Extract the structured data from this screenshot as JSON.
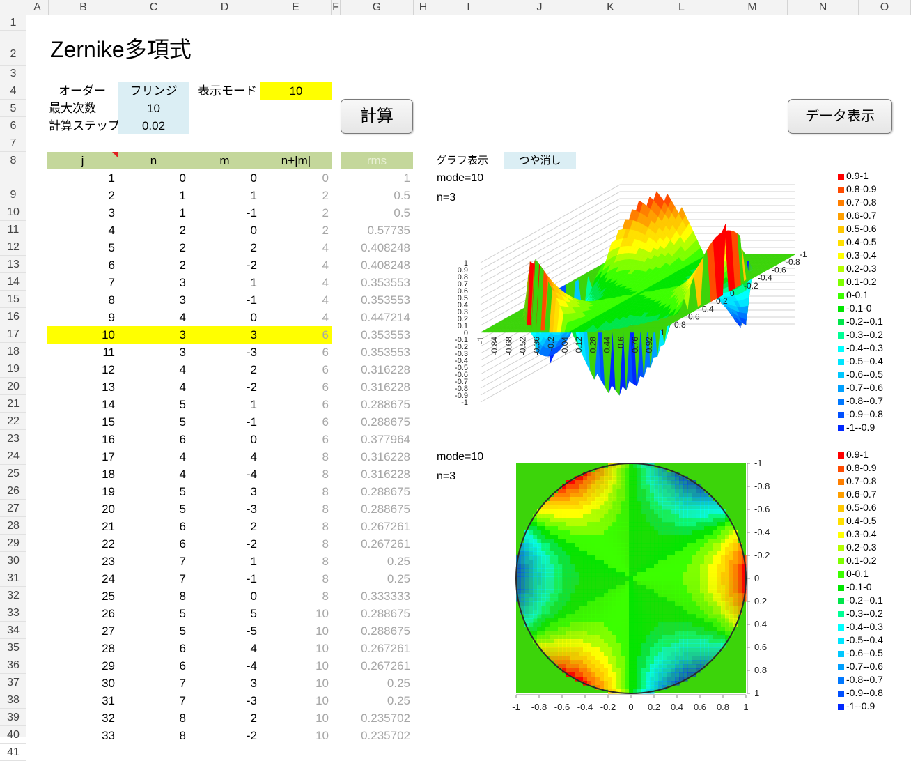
{
  "columns": [
    "A",
    "B",
    "C",
    "D",
    "E",
    "F",
    "G",
    "H",
    "I",
    "J",
    "K",
    "L",
    "M",
    "N",
    "O"
  ],
  "title": "Zernike多項式",
  "settings": {
    "order_label": "オーダー",
    "order_value": "フリンジ",
    "max_degree_label": "最大次数",
    "max_degree_value": "10",
    "step_label": "計算ステップ",
    "step_value": "0.02",
    "mode_label": "表示モード",
    "mode_value": "10"
  },
  "buttons": {
    "calc": "計算",
    "data": "データ表示"
  },
  "table_headers": {
    "j": "j",
    "n": "n",
    "m": "m",
    "nm": "n+|m|",
    "rms": "rms"
  },
  "graph_display": {
    "label": "グラフ表示",
    "value": "つや消し"
  },
  "rows": [
    {
      "j": "1",
      "n": "0",
      "m": "0",
      "nm": "0",
      "rms": "1"
    },
    {
      "j": "2",
      "n": "1",
      "m": "1",
      "nm": "2",
      "rms": "0.5"
    },
    {
      "j": "3",
      "n": "1",
      "m": "-1",
      "nm": "2",
      "rms": "0.5"
    },
    {
      "j": "4",
      "n": "2",
      "m": "0",
      "nm": "2",
      "rms": "0.57735"
    },
    {
      "j": "5",
      "n": "2",
      "m": "2",
      "nm": "4",
      "rms": "0.408248"
    },
    {
      "j": "6",
      "n": "2",
      "m": "-2",
      "nm": "4",
      "rms": "0.408248"
    },
    {
      "j": "7",
      "n": "3",
      "m": "1",
      "nm": "4",
      "rms": "0.353553"
    },
    {
      "j": "8",
      "n": "3",
      "m": "-1",
      "nm": "4",
      "rms": "0.353553"
    },
    {
      "j": "9",
      "n": "4",
      "m": "0",
      "nm": "4",
      "rms": "0.447214"
    },
    {
      "j": "10",
      "n": "3",
      "m": "3",
      "nm": "6",
      "rms": "0.353553",
      "highlight": true
    },
    {
      "j": "11",
      "n": "3",
      "m": "-3",
      "nm": "6",
      "rms": "0.353553"
    },
    {
      "j": "12",
      "n": "4",
      "m": "2",
      "nm": "6",
      "rms": "0.316228"
    },
    {
      "j": "13",
      "n": "4",
      "m": "-2",
      "nm": "6",
      "rms": "0.316228"
    },
    {
      "j": "14",
      "n": "5",
      "m": "1",
      "nm": "6",
      "rms": "0.288675"
    },
    {
      "j": "15",
      "n": "5",
      "m": "-1",
      "nm": "6",
      "rms": "0.288675"
    },
    {
      "j": "16",
      "n": "6",
      "m": "0",
      "nm": "6",
      "rms": "0.377964"
    },
    {
      "j": "17",
      "n": "4",
      "m": "4",
      "nm": "8",
      "rms": "0.316228"
    },
    {
      "j": "18",
      "n": "4",
      "m": "-4",
      "nm": "8",
      "rms": "0.316228"
    },
    {
      "j": "19",
      "n": "5",
      "m": "3",
      "nm": "8",
      "rms": "0.288675"
    },
    {
      "j": "20",
      "n": "5",
      "m": "-3",
      "nm": "8",
      "rms": "0.288675"
    },
    {
      "j": "21",
      "n": "6",
      "m": "2",
      "nm": "8",
      "rms": "0.267261"
    },
    {
      "j": "22",
      "n": "6",
      "m": "-2",
      "nm": "8",
      "rms": "0.267261"
    },
    {
      "j": "23",
      "n": "7",
      "m": "1",
      "nm": "8",
      "rms": "0.25"
    },
    {
      "j": "24",
      "n": "7",
      "m": "-1",
      "nm": "8",
      "rms": "0.25"
    },
    {
      "j": "25",
      "n": "8",
      "m": "0",
      "nm": "8",
      "rms": "0.333333"
    },
    {
      "j": "26",
      "n": "5",
      "m": "5",
      "nm": "10",
      "rms": "0.288675"
    },
    {
      "j": "27",
      "n": "5",
      "m": "-5",
      "nm": "10",
      "rms": "0.288675"
    },
    {
      "j": "28",
      "n": "6",
      "m": "4",
      "nm": "10",
      "rms": "0.267261"
    },
    {
      "j": "29",
      "n": "6",
      "m": "-4",
      "nm": "10",
      "rms": "0.267261"
    },
    {
      "j": "30",
      "n": "7",
      "m": "3",
      "nm": "10",
      "rms": "0.25"
    },
    {
      "j": "31",
      "n": "7",
      "m": "-3",
      "nm": "10",
      "rms": "0.25"
    },
    {
      "j": "32",
      "n": "8",
      "m": "2",
      "nm": "10",
      "rms": "0.235702"
    },
    {
      "j": "33",
      "n": "8",
      "m": "-2",
      "nm": "10",
      "rms": "0.235702"
    }
  ],
  "chart_data": [
    {
      "type": "surface",
      "annotations": [
        "mode=10",
        "n=3"
      ],
      "z_ticks": [
        "1",
        "0.9",
        "0.8",
        "0.7",
        "0.6",
        "0.5",
        "0.4",
        "0.3",
        "0.2",
        "0.1",
        "0",
        "-0.1",
        "-0.2",
        "-0.3",
        "-0.4",
        "-0.5",
        "-0.6",
        "-0.7",
        "-0.8",
        "-0.9",
        "-1"
      ],
      "x_ticks": [
        "-1",
        "-0.84",
        "-0.68",
        "-0.52",
        "-0.36",
        "-0.2",
        "-0.04",
        "0.12",
        "0.28",
        "0.44",
        "0.6",
        "0.76",
        "0.92"
      ],
      "y_ticks": [
        "-1",
        "-0.8",
        "-0.6",
        "-0.4",
        "-0.2",
        "0",
        "0.2",
        "0.4",
        "0.6",
        "0.8",
        "1"
      ],
      "legend": [
        "0.9-1",
        "0.8-0.9",
        "0.7-0.8",
        "0.6-0.7",
        "0.5-0.6",
        "0.4-0.5",
        "0.3-0.4",
        "0.2-0.3",
        "0.1-0.2",
        "0-0.1",
        "-0.1-0",
        "-0.2--0.1",
        "-0.3--0.2",
        "-0.4--0.3",
        "-0.5--0.4",
        "-0.6--0.5",
        "-0.7--0.6",
        "-0.8--0.7",
        "-0.9--0.8",
        "-1--0.9"
      ],
      "legend_colors": [
        "#ff0000",
        "#ff4b00",
        "#ff7f00",
        "#ff9f00",
        "#ffc800",
        "#ffe000",
        "#ffff00",
        "#b4ff00",
        "#7fff00",
        "#3cff00",
        "#00e600",
        "#00e64b",
        "#00ff96",
        "#00ffff",
        "#00e6ff",
        "#00c8ff",
        "#00a0ff",
        "#0078ff",
        "#0050ff",
        "#0028ff"
      ]
    },
    {
      "type": "contour",
      "annotations": [
        "mode=10",
        "n=3"
      ],
      "x_ticks": [
        "-1",
        "-0.8",
        "-0.6",
        "-0.4",
        "-0.2",
        "0",
        "0.2",
        "0.4",
        "0.6",
        "0.8",
        "1"
      ],
      "y_ticks": [
        "-1",
        "-0.8",
        "-0.6",
        "-0.4",
        "-0.2",
        "0",
        "0.2",
        "0.4",
        "0.6",
        "0.8",
        "1"
      ],
      "xlim": [
        -1,
        1
      ],
      "ylim": [
        -1,
        1
      ],
      "legend": [
        "0.9-1",
        "0.8-0.9",
        "0.7-0.8",
        "0.6-0.7",
        "0.5-0.6",
        "0.4-0.5",
        "0.3-0.4",
        "0.2-0.3",
        "0.1-0.2",
        "0-0.1",
        "-0.1-0",
        "-0.2--0.1",
        "-0.3--0.2",
        "-0.4--0.3",
        "-0.5--0.4",
        "-0.6--0.5",
        "-0.7--0.6",
        "-0.8--0.7",
        "-0.9--0.8",
        "-1--0.9"
      ],
      "legend_colors": [
        "#ff0000",
        "#ff4b00",
        "#ff7f00",
        "#ff9f00",
        "#ffc800",
        "#ffe000",
        "#ffff00",
        "#b4ff00",
        "#7fff00",
        "#3cff00",
        "#00e600",
        "#00e64b",
        "#00ff96",
        "#00ffff",
        "#00e6ff",
        "#00c8ff",
        "#00a0ff",
        "#0078ff",
        "#0050ff",
        "#0028ff"
      ]
    }
  ]
}
